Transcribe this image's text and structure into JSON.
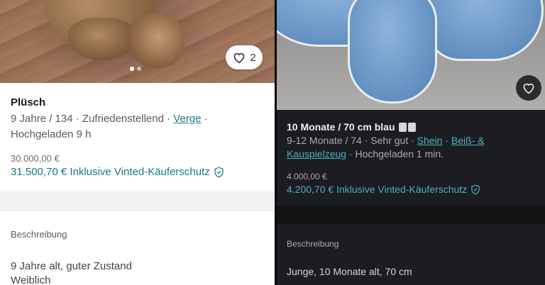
{
  "left": {
    "like_count": "2",
    "title": "Plüsch",
    "meta_prefix": "9 Jahre / 134 · Zufriedenstellend · ",
    "meta_brand": "Verge",
    "meta_suffix": " ·",
    "meta_line2": "Hochgeladen 9 h",
    "price": "30.000,00 €",
    "price_total": "31.500,70 € Inklusive Vinted-Käuferschutz",
    "description_heading": "Beschreibung",
    "description_line1": "9 Jahre alt, guter Zustand",
    "description_line2": "Weiblich",
    "icons": {
      "like": "heart-icon",
      "protection": "shield-check-icon"
    }
  },
  "right": {
    "title": "10 Monate / 70 cm blau",
    "meta_prefix": "9-12 Monate / 74 · Sehr gut · ",
    "meta_brand": "Shein",
    "meta_sep": " · ",
    "meta_category": "Beiß- &",
    "meta_category2": "Kauspielzeug",
    "meta_suffix": " · Hochgeladen 1 min.",
    "price": "4.000,00 €",
    "price_total": "4.200,70 € Inklusive Vinted-Käuferschutz",
    "description_heading": "Beschreibung",
    "description_line1": "Junge, 10 Monate alt, 70 cm",
    "icons": {
      "like": "heart-icon",
      "protection": "shield-check-icon"
    }
  },
  "colors": {
    "accent_light": "#157a80",
    "accent_dark": "#4db1ba"
  }
}
